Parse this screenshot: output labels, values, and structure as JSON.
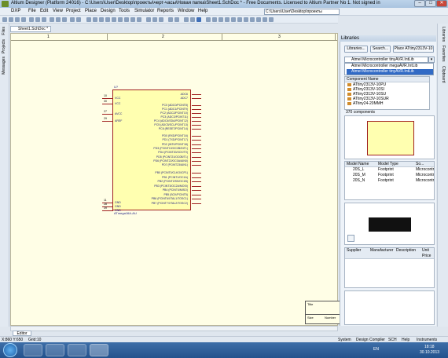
{
  "window": {
    "title": "Altium Designer (Platform 24016) - C:\\Users\\User\\Desktop\\проекты\\черт-часы\\Новая папка\\Sheet1.SchDoc * - Free Documents. Licensed to Altium Partner No 1. Not signed in",
    "minimize": "–",
    "maximize": "□",
    "close": "✕"
  },
  "menu": {
    "items": [
      "DXP",
      "File",
      "Edit",
      "View",
      "Project",
      "Place",
      "Design",
      "Tools",
      "Simulator",
      "Reports",
      "Window",
      "Help"
    ],
    "path": "C:\\Users\\User\\Desktop\\проекты"
  },
  "left_tabs": [
    "Files",
    "Projects",
    "Messages"
  ],
  "document_tab": "Sheet1.SchDoc *",
  "ruler": {
    "marks": [
      "1",
      "2",
      "3"
    ]
  },
  "component": {
    "designator": "U?",
    "part": "ATmega16A-AU",
    "left_pins": [
      {
        "num": "10",
        "name": "VCC"
      },
      {
        "num": "30",
        "name": "VCC"
      },
      {
        "num": "27",
        "name": "AVCC"
      },
      {
        "num": "29",
        "name": "AREF"
      },
      {
        "num": "11",
        "name": "GND"
      },
      {
        "num": "28",
        "name": "GND"
      },
      {
        "num": "39",
        "name": "GND"
      }
    ],
    "right_pins": [
      "ADC6",
      "ADC7",
      "PC0 (ADC0/PCINT8)",
      "PC1 (ADC1/PCINT9)",
      "PC2 (ADC2/PCINT10)",
      "PC3 (ADC3/PCINT11)",
      "PC4 (ADC4/SDA/PCINT12)",
      "PC5 (ADC5/SCL/PCINT13)",
      "PC6 (RESET/PCINT14)",
      "PD0 (RXD/PCINT16)",
      "PD1 (TXD/PCINT17)",
      "PD2 (INT0/PCINT18)",
      "PD3 (PCINT19/OC2B/INT1)",
      "PD4 (PCINT20/XCK/T0)",
      "PD5 (PCINT21/OC0B/T1)",
      "PD6 (PCINT22/OC0A/AIN0)",
      "PD7 (PCINT23/AIN1)",
      "PB0 (PCINT0/CLKO/ICP1)",
      "PB1 (PCINT1/OC1A)",
      "PB2 (PCINT2/SS/OC1B)",
      "PB3 (PCINT3/OC2A/MOSI)",
      "PB4 (PCINT4/MISO)",
      "PB5 (SCK/PCINT5)",
      "PB6 (PCINT6/XTAL1/TOSC1)",
      "PB7 (PCINT7/XTAL2/TOSC2)"
    ]
  },
  "title_block": {
    "title": "Title",
    "size": "Size",
    "number": "Number"
  },
  "editor_tab": "Editor",
  "libraries": {
    "panel_title": "Libraries",
    "btn_libraries": "Libraries...",
    "btn_search": "Search...",
    "btn_place": "Place ATtiny2313V-10",
    "selected_lib": "Atmel Microcontroller tinyAVR.IntLib",
    "dropdown": [
      "Atmel Microcontroller megaAVR.IntLib",
      "Atmel Microcontroller tinyAVR.IntLib"
    ],
    "list_header": "Component Name",
    "components": [
      "ATtiny2313V-10PU",
      "ATtiny2313V-10SI",
      "ATtiny2313V-10SU",
      "ATtiny2313V-10SUR",
      "ATtiny24-20MMH"
    ],
    "count": "370 components",
    "model_columns": [
      "Model Name",
      "Model Type",
      "So..."
    ],
    "models": [
      {
        "name": "20S_L",
        "type": "Footprint",
        "src": "Microcontr"
      },
      {
        "name": "20S_M",
        "type": "Footprint",
        "src": "Microcontr"
      },
      {
        "name": "20S_N",
        "type": "Footprint",
        "src": "Microcontr"
      }
    ],
    "supplier_columns": [
      "Supplier",
      "Manufacturer",
      "Description",
      "Unit Price"
    ]
  },
  "right_tabs": [
    "Libraries",
    "Favorites",
    "Clipboard"
  ],
  "status": {
    "coords": "X:860 Y:650",
    "grid": "Grid:10",
    "links": [
      "System",
      "Design Compiler",
      "SCH",
      "Help",
      "Instruments"
    ]
  },
  "taskbar": {
    "lang": "EN",
    "time": "18:18",
    "date": "30.10.2013"
  },
  "colors": {
    "sheet": "#fffee6",
    "chip_fill": "#ffffb0",
    "chip_border": "#a02020",
    "accent": "#316ac5"
  }
}
